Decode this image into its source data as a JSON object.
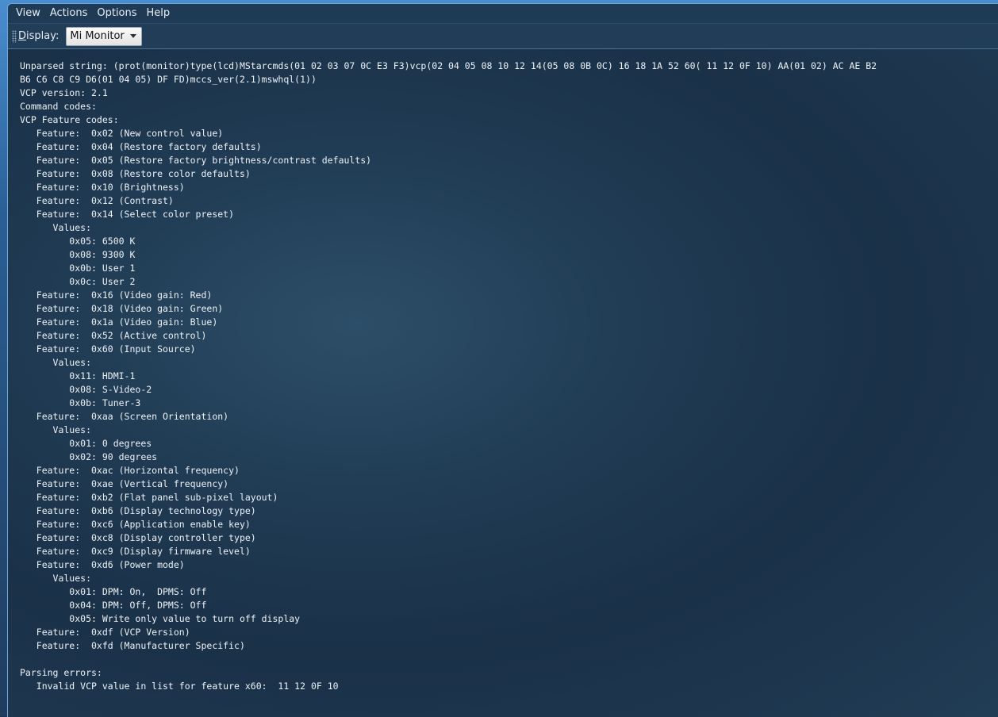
{
  "menu": {
    "items": [
      "View",
      "Actions",
      "Options",
      "Help"
    ]
  },
  "toolbar": {
    "display_label_mnemonic": "D",
    "display_label_rest": "isplay:",
    "selected_display": "Mi Monitor"
  },
  "output": {
    "lines": [
      "Unparsed string: (prot(monitor)type(lcd)MStarcmds(01 02 03 07 0C E3 F3)vcp(02 04 05 08 10 12 14(05 08 0B 0C) 16 18 1A 52 60( 11 12 0F 10) AA(01 02) AC AE B2",
      "B6 C6 C8 C9 D6(01 04 05) DF FD)mccs_ver(2.1)mswhql(1))",
      "VCP version: 2.1",
      "Command codes:",
      "VCP Feature codes:",
      "   Feature:  0x02 (New control value)",
      "   Feature:  0x04 (Restore factory defaults)",
      "   Feature:  0x05 (Restore factory brightness/contrast defaults)",
      "   Feature:  0x08 (Restore color defaults)",
      "   Feature:  0x10 (Brightness)",
      "   Feature:  0x12 (Contrast)",
      "   Feature:  0x14 (Select color preset)",
      "      Values:",
      "         0x05: 6500 K",
      "         0x08: 9300 K",
      "         0x0b: User 1",
      "         0x0c: User 2",
      "   Feature:  0x16 (Video gain: Red)",
      "   Feature:  0x18 (Video gain: Green)",
      "   Feature:  0x1a (Video gain: Blue)",
      "   Feature:  0x52 (Active control)",
      "   Feature:  0x60 (Input Source)",
      "      Values:",
      "         0x11: HDMI-1",
      "         0x08: S-Video-2",
      "         0x0b: Tuner-3",
      "   Feature:  0xaa (Screen Orientation)",
      "      Values:",
      "         0x01: 0 degrees",
      "         0x02: 90 degrees",
      "   Feature:  0xac (Horizontal frequency)",
      "   Feature:  0xae (Vertical frequency)",
      "   Feature:  0xb2 (Flat panel sub-pixel layout)",
      "   Feature:  0xb6 (Display technology type)",
      "   Feature:  0xc6 (Application enable key)",
      "   Feature:  0xc8 (Display controller type)",
      "   Feature:  0xc9 (Display firmware level)",
      "   Feature:  0xd6 (Power mode)",
      "      Values:",
      "         0x01: DPM: On,  DPMS: Off",
      "         0x04: DPM: Off, DPMS: Off",
      "         0x05: Write only value to turn off display",
      "   Feature:  0xdf (VCP Version)",
      "   Feature:  0xfd (Manufacturer Specific)",
      "",
      "Parsing errors:",
      "   Invalid VCP value in list for feature x60:  11 12 0F 10"
    ]
  }
}
